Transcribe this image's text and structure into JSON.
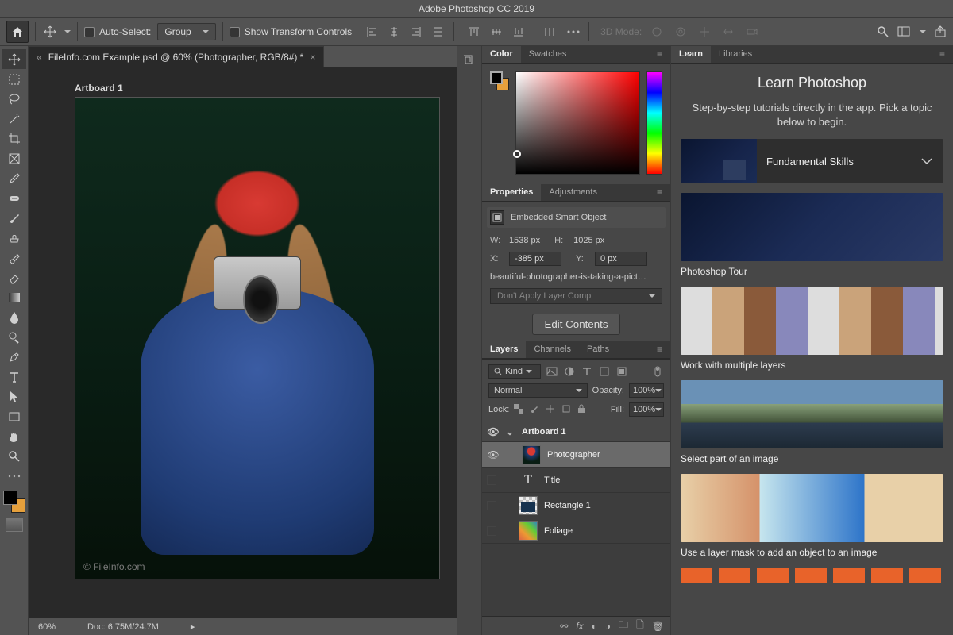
{
  "app_title": "Adobe Photoshop CC 2019",
  "options_bar": {
    "auto_select_label": "Auto-Select:",
    "auto_select_target": "Group",
    "show_transform_label": "Show Transform Controls",
    "three_d_label": "3D Mode:"
  },
  "document": {
    "tab_title": "FileInfo.com Example.psd @ 60% (Photographer, RGB/8#) *",
    "artboard_label": "Artboard 1",
    "watermark": "© FileInfo.com",
    "zoom": "60%",
    "doc_info": "Doc: 6.75M/24.7M"
  },
  "color_panel": {
    "tabs": [
      "Color",
      "Swatches"
    ]
  },
  "properties_panel": {
    "tabs": [
      "Properties",
      "Adjustments"
    ],
    "type_label": "Embedded Smart Object",
    "w_label": "W:",
    "w_value": "1538 px",
    "h_label": "H:",
    "h_value": "1025 px",
    "x_label": "X:",
    "x_value": "-385 px",
    "y_label": "Y:",
    "y_value": "0 px",
    "filename": "beautiful-photographer-is-taking-a-pict…",
    "layer_comp": "Don't Apply Layer Comp",
    "edit_contents": "Edit Contents"
  },
  "layers_panel": {
    "tabs": [
      "Layers",
      "Channels",
      "Paths"
    ],
    "kind_label": "Kind",
    "blend_mode": "Normal",
    "opacity_label": "Opacity:",
    "opacity_value": "100%",
    "lock_label": "Lock:",
    "fill_label": "Fill:",
    "fill_value": "100%",
    "layers": [
      {
        "name": "Artboard 1",
        "type": "artboard",
        "visible": true
      },
      {
        "name": "Photographer",
        "type": "photo",
        "visible": true,
        "selected": true
      },
      {
        "name": "Title",
        "type": "text",
        "visible": false
      },
      {
        "name": "Rectangle 1",
        "type": "rect",
        "visible": false
      },
      {
        "name": "Foliage",
        "type": "foliage",
        "visible": false
      }
    ]
  },
  "learn_panel": {
    "tabs": [
      "Learn",
      "Libraries"
    ],
    "title": "Learn Photoshop",
    "subtitle": "Step-by-step tutorials directly in the app. Pick a topic below to begin.",
    "accordion": "Fundamental Skills",
    "tutorials": [
      "Photoshop Tour",
      "Work with multiple layers",
      "Select part of an image",
      "Use a layer mask to add an object to an image"
    ]
  }
}
